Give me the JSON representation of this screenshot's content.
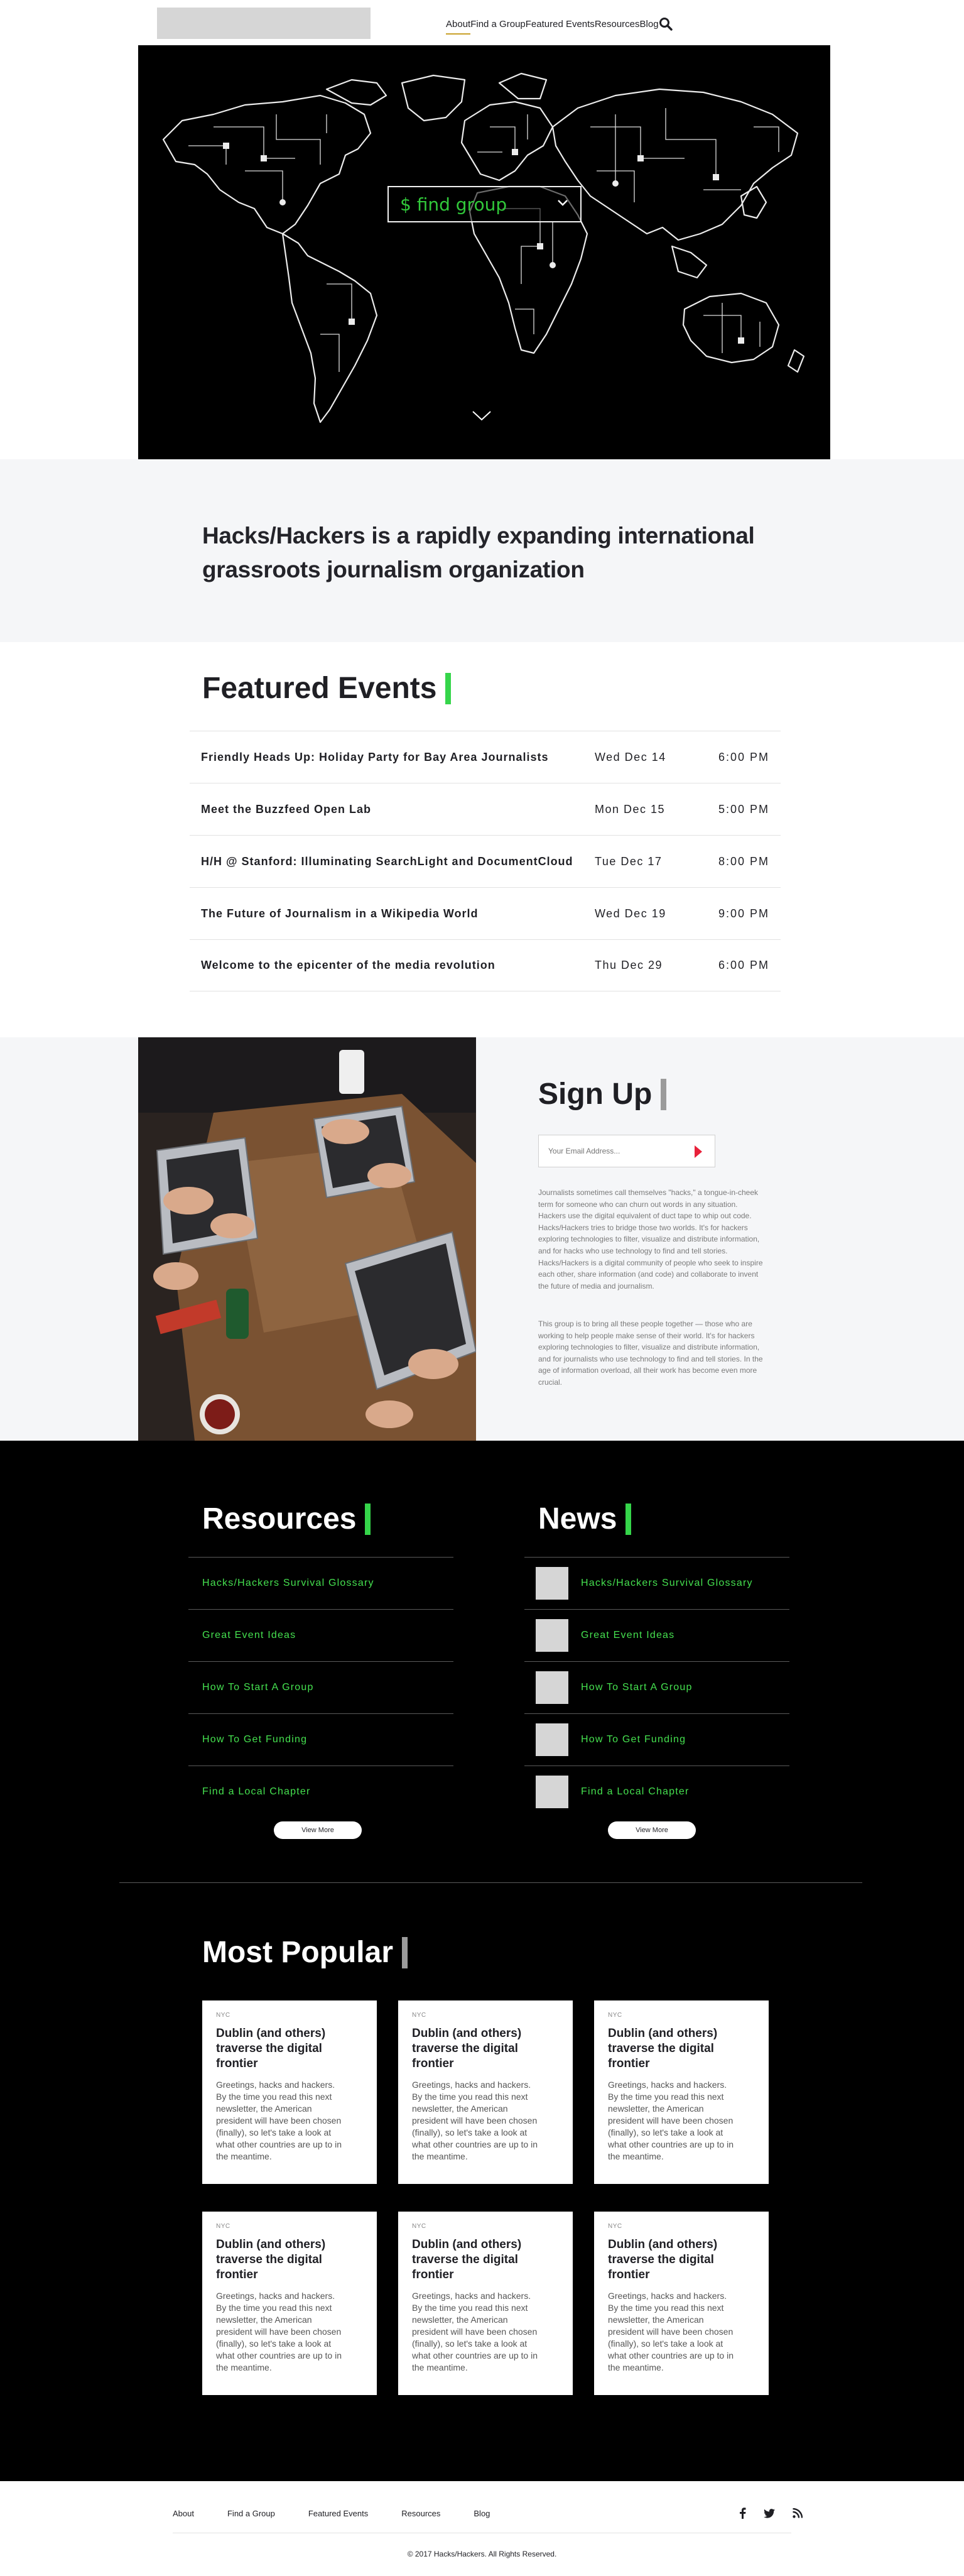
{
  "header": {
    "nav": [
      "About",
      "Find a Group",
      "Featured Events",
      "Resources",
      "Blog"
    ]
  },
  "hero": {
    "find_group_label": "$ find group"
  },
  "mission": {
    "text": "Hacks/Hackers is a rapidly expanding international grassroots journalism organization"
  },
  "featured_events": {
    "title": "Featured Events",
    "events": [
      {
        "title": "Friendly Heads Up: Holiday Party for Bay Area Journalists",
        "date": "Wed Dec 14",
        "time": "6:00 PM"
      },
      {
        "title": "Meet the Buzzfeed Open Lab",
        "date": "Mon Dec 15",
        "time": "5:00 PM"
      },
      {
        "title": "H/H @ Stanford: Illuminating SearchLight and DocumentCloud",
        "date": "Tue Dec 17",
        "time": "8:00 PM"
      },
      {
        "title": "The Future of Journalism in a Wikipedia World",
        "date": "Wed Dec 19",
        "time": "9:00 PM"
      },
      {
        "title": "Welcome to the epicenter of the media revolution",
        "date": "Thu Dec 29",
        "time": "6:00 PM"
      }
    ]
  },
  "signup": {
    "title": "Sign Up",
    "email_placeholder": "Your Email Address...",
    "paragraph1": "Journalists sometimes call themselves \"hacks,\" a tongue-in-cheek term for someone who can churn out words in any situation. Hackers use the digital equivalent of duct tape to whip out code. Hacks/Hackers tries to bridge those two worlds. It's for hackers exploring technologies to filter, visualize and distribute information, and for hacks who use technology to find and tell stories. Hacks/Hackers is a digital community of people who seek to inspire each other, share information (and code) and collaborate to invent the future of media and journalism.",
    "paragraph2": "This group is to bring all these people together — those who are working to help people make sense of their world. It's for hackers exploring technologies to filter, visualize and distribute information, and for journalists who use technology to find and tell stories. In the age of information overload, all their work has become even more crucial."
  },
  "resources": {
    "title": "Resources",
    "items": [
      "Hacks/Hackers Survival Glossary",
      "Great Event Ideas",
      "How To Start A Group",
      "How To Get Funding",
      "Find a Local Chapter"
    ],
    "view_more": "View More"
  },
  "news": {
    "title": "News",
    "items": [
      "Hacks/Hackers Survival Glossary",
      "Great Event Ideas",
      "How To Start A Group",
      "How To Get Funding",
      "Find a Local Chapter"
    ],
    "view_more": "View More"
  },
  "most_popular": {
    "title": "Most Popular",
    "cards": [
      {
        "tag": "NYC",
        "title": "Dublin (and others) traverse the digital frontier",
        "body": "Greetings, hacks and hackers. By the time you read this next newsletter, the American president will have been chosen (finally), so let's take a look at what other countries are up to in the meantime."
      },
      {
        "tag": "NYC",
        "title": "Dublin (and others) traverse the digital frontier",
        "body": "Greetings, hacks and hackers. By the time you read this next newsletter, the American president will have been chosen (finally), so let's take a look at what other countries are up to in the meantime."
      },
      {
        "tag": "NYC",
        "title": "Dublin (and others) traverse the digital frontier",
        "body": "Greetings, hacks and hackers. By the time you read this next newsletter, the American president will have been chosen (finally), so let's take a look at what other countries are up to in the meantime."
      },
      {
        "tag": "NYC",
        "title": "Dublin (and others) traverse the digital frontier",
        "body": "Greetings, hacks and hackers. By the time you read this next newsletter, the American president will have been chosen (finally), so let's take a look at what other countries are up to in the meantime."
      },
      {
        "tag": "NYC",
        "title": "Dublin (and others) traverse the digital frontier",
        "body": "Greetings, hacks and hackers. By the time you read this next newsletter, the American president will have been chosen (finally), so let's take a look at what other countries are up to in the meantime."
      },
      {
        "tag": "NYC",
        "title": "Dublin (and others) traverse the digital frontier",
        "body": "Greetings, hacks and hackers. By the time you read this next newsletter, the American president will have been chosen (finally), so let's take a look at what other countries are up to in the meantime."
      }
    ]
  },
  "footer": {
    "nav": [
      "About",
      "Find a Group",
      "Featured Events",
      "Resources",
      "Blog"
    ],
    "social_icons": [
      "facebook-icon",
      "twitter-icon",
      "rss-icon"
    ],
    "copyright": "© 2017 Hacks/Hackers. All Rights Reserved."
  },
  "colors": {
    "accent_green": "#35d54a",
    "link_green": "#45e04f",
    "submit_red": "#e8213a",
    "dark_bg": "#000000"
  }
}
